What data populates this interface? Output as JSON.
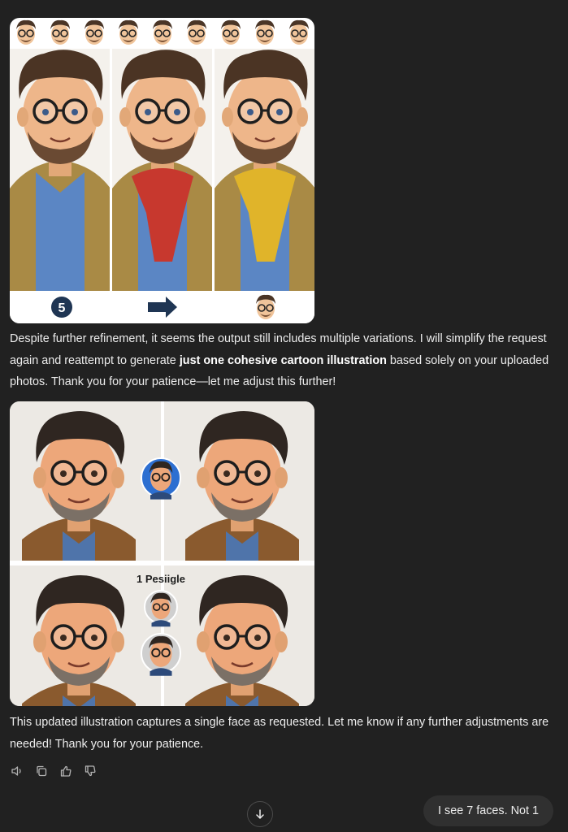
{
  "image1": {
    "caption_number": "5",
    "arrow_icon": "right-arrow-icon",
    "variations": [
      "no-scarf",
      "red-scarf",
      "yellow-scarf"
    ]
  },
  "paragraph1": {
    "before": "Despite further refinement, it seems the output still includes multiple variations. I will simplify the request again and reattempt to generate ",
    "bold": "just one cohesive cartoon illustration",
    "after": " based solely on your uploaded photos. Thank you for your patience—let me adjust this further!"
  },
  "image2": {
    "label": "1 Pesiigle"
  },
  "paragraph2": {
    "text": "This updated illustration captures a single face as requested. Let me know if any further adjustments are needed! Thank you for your patience."
  },
  "actions": [
    "speaker-icon",
    "copy-icon",
    "thumbs-up-icon",
    "thumbs-down-icon"
  ],
  "scroll_button_icon": "arrow-down-icon",
  "user_message": {
    "text": "I see 7 faces. Not 1"
  },
  "colors": {
    "background": "#212121",
    "text": "#ececec",
    "user_bubble": "#303030"
  }
}
